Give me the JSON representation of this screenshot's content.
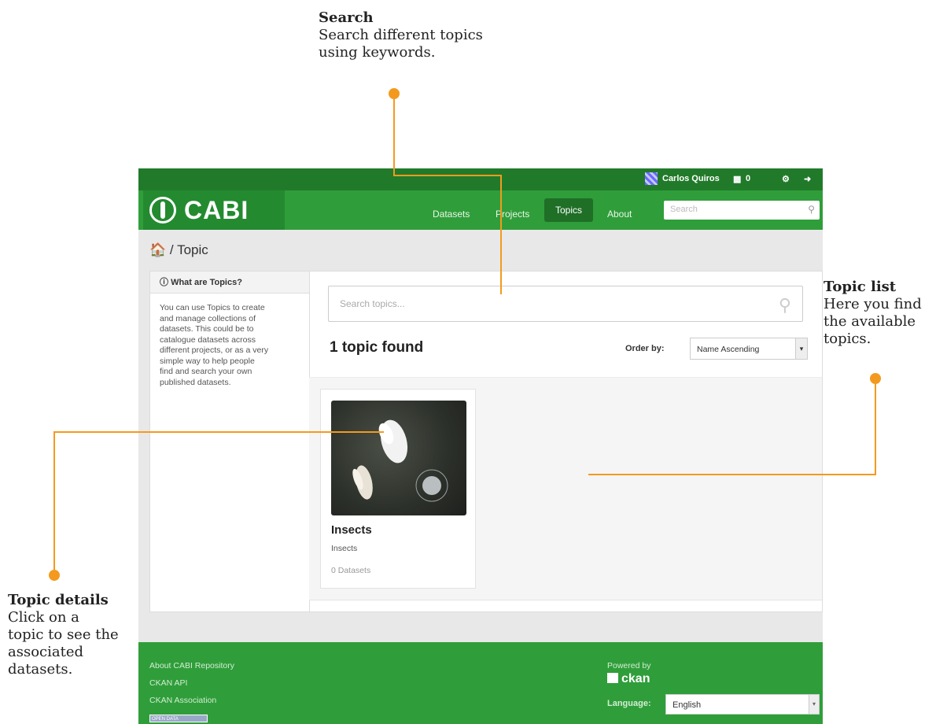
{
  "callouts": {
    "search": {
      "title": "Search",
      "lines": [
        "Search different topics",
        "using keywords."
      ]
    },
    "topic_list": {
      "title": "Topic list",
      "lines": [
        "Here you find",
        "the available",
        "topics."
      ]
    },
    "topic_details": {
      "title": "Topic details",
      "lines": [
        "Click on a",
        "topic to see the",
        "associated",
        "datasets."
      ]
    }
  },
  "account": {
    "user_name": "Carlos Quiros",
    "dashboard_count": "0"
  },
  "masthead": {
    "logo_text": "CABI",
    "nav": [
      "Datasets",
      "Projects",
      "Topics",
      "About"
    ],
    "active_nav": "Topics",
    "search_placeholder": "Search"
  },
  "breadcrumb": {
    "sep": "/",
    "current": "Topic"
  },
  "sidebar": {
    "heading": "What are Topics?",
    "lines": [
      "You can use Topics to create",
      "and manage collections of",
      "datasets. This could be to",
      "catalogue datasets across",
      "different projects, or as a very",
      "simple way to help people",
      "find and search your own",
      "published datasets."
    ]
  },
  "main": {
    "search_placeholder": "Search topics...",
    "found_text": "1 topic found",
    "order_label": "Order by:",
    "order_value": "Name Ascending",
    "topics": [
      {
        "title": "Insects",
        "description": "Insects",
        "count": "0 Datasets"
      }
    ]
  },
  "footer": {
    "links": [
      "About CABI Repository",
      "CKAN API",
      "CKAN Association"
    ],
    "badge": "OPEN DATA",
    "powered_by": "Powered by",
    "ckan": "ckan",
    "language_label": "Language:",
    "language_value": "English"
  },
  "colors": {
    "accent_orange": "#f39a1e",
    "brand_green": "#2f9e3a",
    "dark_green": "#217a2a"
  }
}
